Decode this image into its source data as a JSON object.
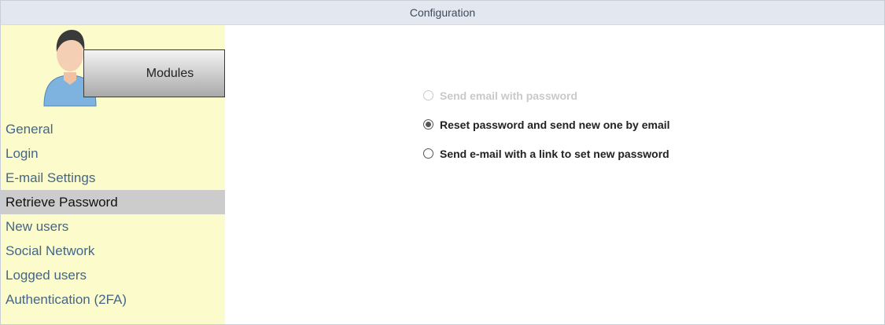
{
  "window": {
    "title": "Configuration"
  },
  "sidebar": {
    "modules_label": "Modules",
    "items": [
      {
        "label": "General"
      },
      {
        "label": "Login"
      },
      {
        "label": "E-mail Settings"
      },
      {
        "label": "Retrieve Password",
        "active": true
      },
      {
        "label": "New users"
      },
      {
        "label": "Social Network"
      },
      {
        "label": "Logged users"
      },
      {
        "label": "Authentication (2FA)"
      }
    ]
  },
  "main": {
    "options": [
      {
        "label": "Send email with password",
        "disabled": true,
        "selected": false
      },
      {
        "label": "Reset password and send new one by email",
        "disabled": false,
        "selected": true
      },
      {
        "label": "Send e-mail with a link to set new password",
        "disabled": false,
        "selected": false
      }
    ]
  },
  "colors": {
    "sidebar_bg": "#fbfbcb",
    "titlebar_bg": "#e3e8f0",
    "nav_link": "#43668a",
    "nav_active_bg": "#cccccc"
  }
}
